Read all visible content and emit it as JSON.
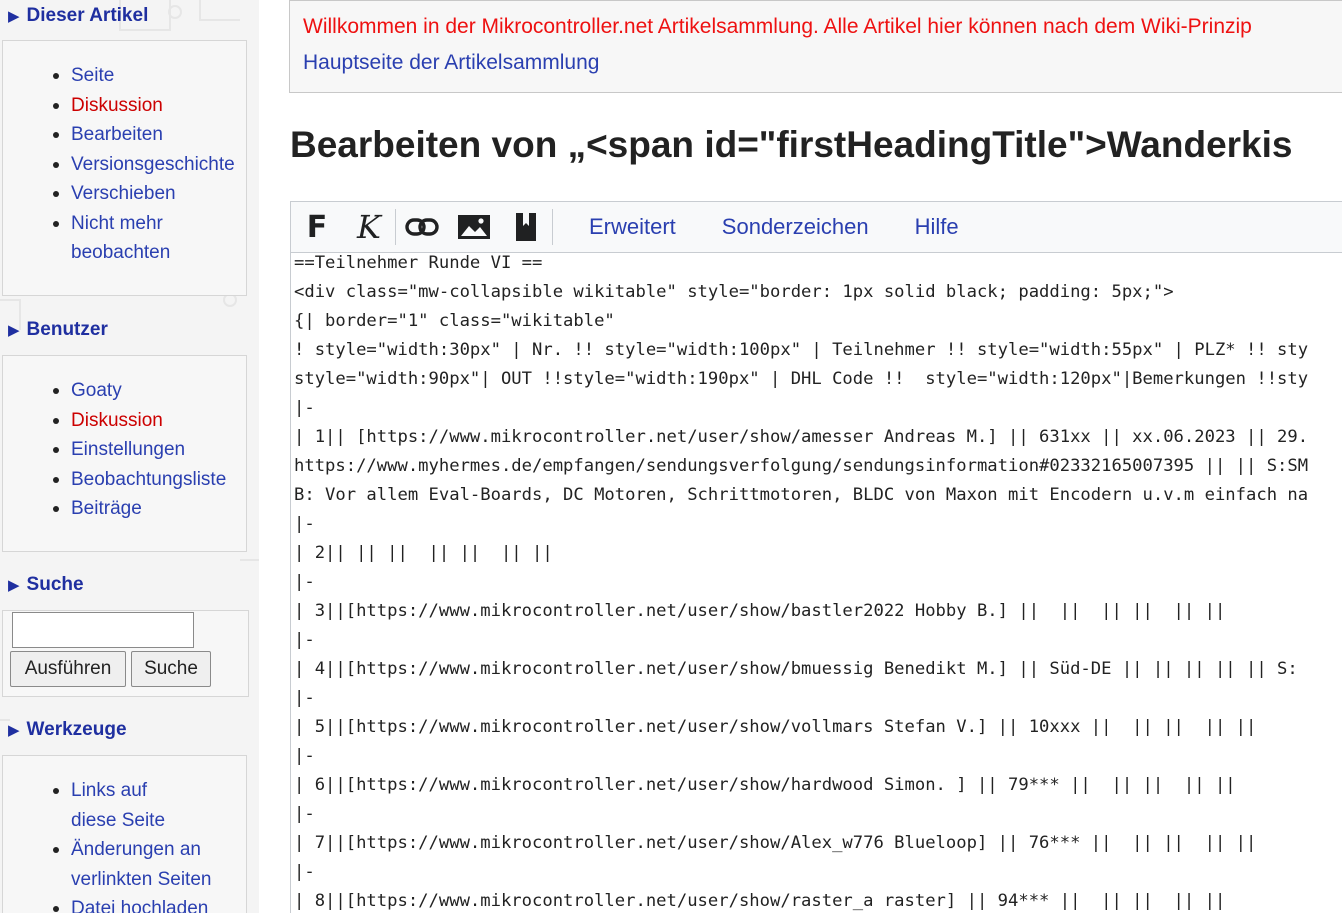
{
  "sidebar": {
    "article": {
      "title": "Dieser Artikel",
      "items": [
        {
          "label": "Seite"
        },
        {
          "label": "Diskussion"
        },
        {
          "label": "Bearbeiten"
        },
        {
          "label": "Versionsgeschichte"
        },
        {
          "label": "Verschieben"
        },
        {
          "label": "Nicht mehr beobachten"
        }
      ]
    },
    "user": {
      "title": "Benutzer",
      "items": [
        {
          "label": "Goaty"
        },
        {
          "label": "Diskussion"
        },
        {
          "label": "Einstellungen"
        },
        {
          "label": "Beobachtungsliste"
        },
        {
          "label": "Beiträge"
        }
      ]
    },
    "search": {
      "title": "Suche",
      "value": "",
      "go_label": "Ausführen",
      "search_label": "Suche"
    },
    "tools": {
      "title": "Werkzeuge",
      "items": [
        {
          "label": "Links auf diese Seite"
        },
        {
          "label": "Änderungen an verlinkten Seiten"
        },
        {
          "label": "Datei hochladen"
        }
      ]
    }
  },
  "notice": {
    "text": "Willkommen in der Mikrocontroller.net Artikelsammlung. Alle Artikel hier können nach dem Wiki-Prinzip",
    "link": "Hauptseite der Artikelsammlung"
  },
  "page_title": "Bearbeiten von „<span id=\"firstHeadingTitle\">Wanderkis",
  "toolbar": {
    "bold_label": "F",
    "italic_label": "K",
    "icons": [
      "bold-icon",
      "italic-icon",
      "link-icon",
      "image-icon",
      "reference-icon"
    ],
    "tabs": [
      "Erweitert",
      "Sonderzeichen",
      "Hilfe"
    ]
  },
  "editor": {
    "lines": [
      "==Teilnehmer Runde VI ==",
      "<div class=\"mw-collapsible wikitable\" style=\"border: 1px solid black; padding: 5px;\">",
      "{| border=\"1\" class=\"wikitable\"",
      "! style=\"width:30px\" | Nr. !! style=\"width:100px\" | Teilnehmer !! style=\"width:55px\" | PLZ* !! sty",
      "style=\"width:90px\"| OUT !!style=\"width:190px\" | DHL Code !!  style=\"width:120px\"|Bemerkungen !!sty",
      "|-",
      "| 1|| [https://www.mikrocontroller.net/user/show/amesser Andreas M.] || 631xx || xx.06.2023 || 29.",
      "https://www.myhermes.de/empfangen/sendungsverfolgung/sendungsinformation#02332165007395 || || S:SM",
      "B: Vor allem Eval-Boards, DC Motoren, Schrittmotoren, BLDC von Maxon mit Encodern u.v.m einfach na",
      "|-",
      "| 2|| || ||  || ||  || ||",
      "|-",
      "| 3||[https://www.mikrocontroller.net/user/show/bastler2022 Hobby B.] ||  ||  || ||  || ||",
      "|-",
      "| 4||[https://www.mikrocontroller.net/user/show/bmuessig Benedikt M.] || Süd-DE || || || || || S:",
      "|-",
      "| 5||[https://www.mikrocontroller.net/user/show/vollmars Stefan V.] || 10xxx ||  || ||  || ||",
      "|-",
      "| 6||[https://www.mikrocontroller.net/user/show/hardwood Simon. ] || 79*** ||  || ||  || ||",
      "|-",
      "| 7||[https://www.mikrocontroller.net/user/show/Alex_w776 Blueloop] || 76*** ||  || ||  || ||",
      "|-",
      "| 8||[https://www.mikrocontroller.net/user/show/raster_a raster] || 94*** ||  || ||  || ||"
    ]
  }
}
